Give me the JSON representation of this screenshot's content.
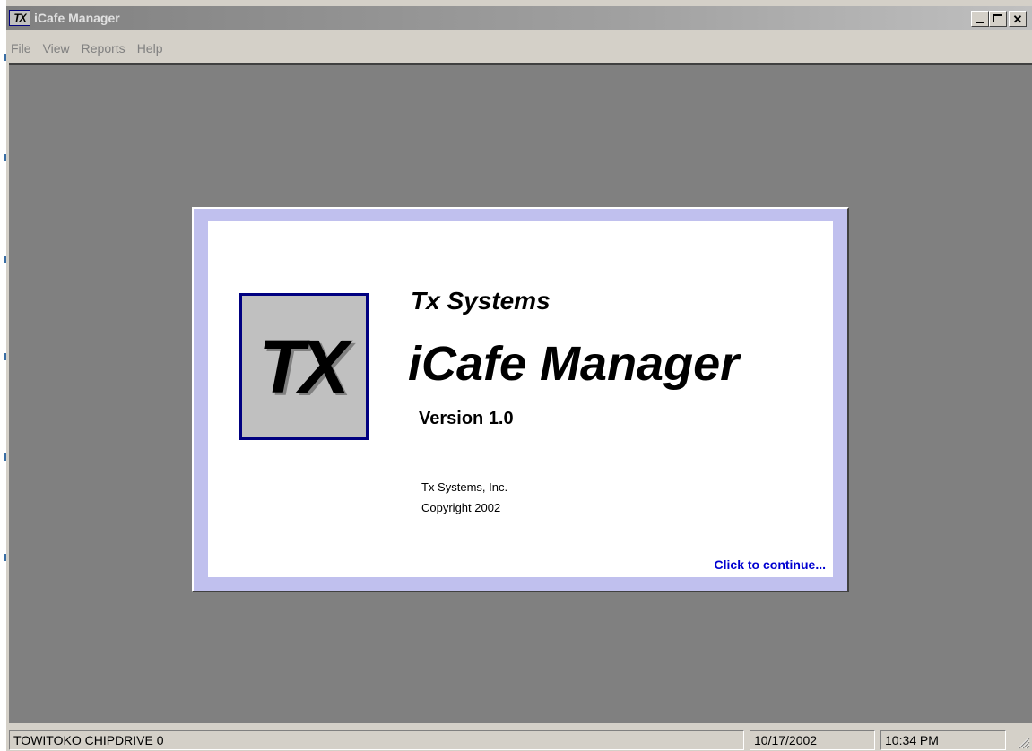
{
  "window": {
    "title": "iCafe Manager",
    "app_icon": "TX",
    "controls": [
      "minimize",
      "maximize",
      "close"
    ]
  },
  "menu": {
    "items": [
      "File",
      "View",
      "Reports",
      "Help"
    ]
  },
  "splash": {
    "logo_text": "TX",
    "company_heading": "Tx Systems",
    "product_name": "iCafe Manager",
    "version": "Version 1.0",
    "company_name": "Tx Systems, Inc.",
    "copyright": "Copyright 2002",
    "continue_link": "Click to continue..."
  },
  "statusbar": {
    "device": "TOWITOKO CHIPDRIVE 0",
    "date": "10/17/2002",
    "time": "10:34 PM"
  },
  "colors": {
    "title_gradient_start": "#808080",
    "client_background": "#808080",
    "splash_frame": "#c0c0ee",
    "logo_border": "#000080",
    "link": "#0000d0"
  },
  "icons": {
    "minimize": "minimize-icon",
    "maximize": "maximize-icon",
    "close": "close-icon",
    "grip": "resize-grip-icon"
  }
}
